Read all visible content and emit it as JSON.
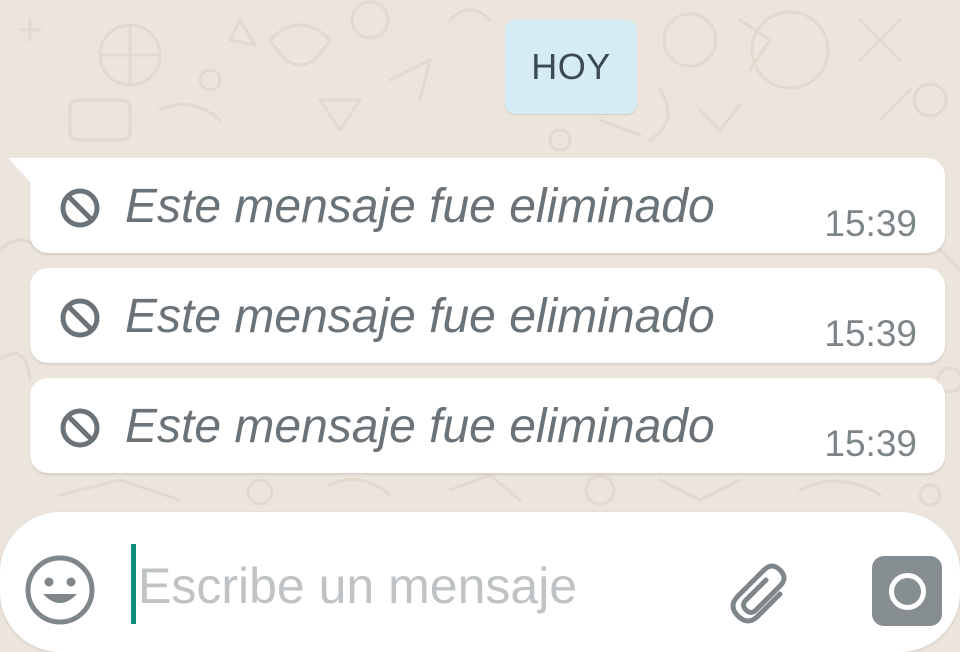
{
  "chat": {
    "date_chip": "HOY",
    "messages": [
      {
        "text": "Este mensaje fue eliminado",
        "time": "15:39",
        "icon": "prohibited-icon"
      },
      {
        "text": "Este mensaje fue eliminado",
        "time": "15:39",
        "icon": "prohibited-icon"
      },
      {
        "text": "Este mensaje fue eliminado",
        "time": "15:39",
        "icon": "prohibited-icon"
      }
    ]
  },
  "composer": {
    "placeholder": "Escribe un mensaje",
    "emoji_icon": "smiley-icon",
    "attach_icon": "paperclip-icon",
    "camera_icon": "camera-icon"
  },
  "colors": {
    "wallpaper": "#ece5dd",
    "date_chip": "#d5ecf5",
    "bubble": "#ffffff",
    "text_deleted": "#6b7378",
    "caret": "#0a8f7c",
    "camera_button": "#878e92"
  }
}
